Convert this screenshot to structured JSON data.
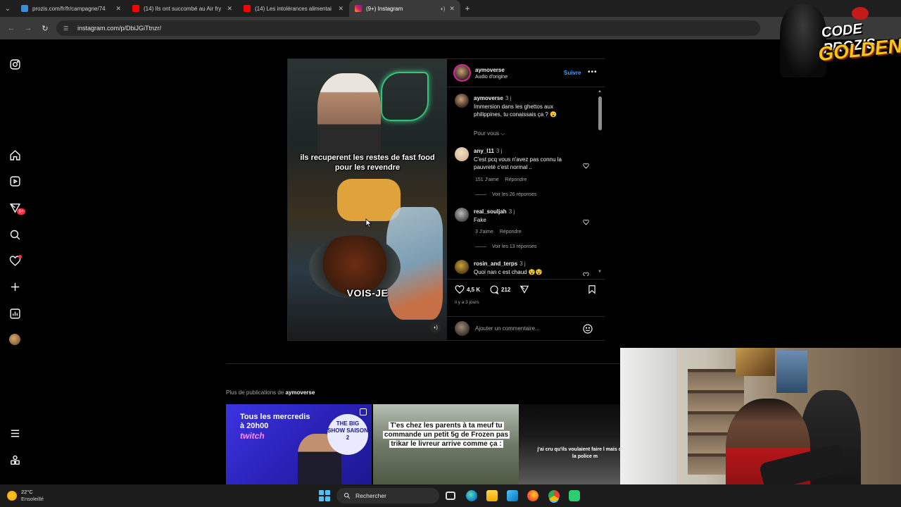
{
  "browser": {
    "tabs": [
      {
        "title": "prozis.com/fr/fr/campagne/74",
        "favicon": "prozis-favicon",
        "active": false
      },
      {
        "title": "(14) Ils ont succombé au Air fry",
        "favicon": "youtube-favicon",
        "active": false
      },
      {
        "title": "(14) Les intolérances alimentai",
        "favicon": "youtube-favicon",
        "active": false
      },
      {
        "title": "(9+) Instagram",
        "favicon": "instagram-favicon",
        "active": true
      }
    ],
    "url": "instagram.com/p/DbiJGiTtnzr/"
  },
  "rail": {
    "notifications_badge": "9+"
  },
  "post": {
    "video": {
      "caption_top": "ils recuperent les restes de fast food pour les revendre",
      "caption_bottom": "VOIS-JE"
    },
    "author": {
      "username": "aymoverse",
      "audio": "Audio d'origine",
      "follow_label": "Suivre"
    },
    "description": {
      "username": "aymoverse",
      "time": "3 j",
      "text": "Immersion dans les ghettos aux philippines, tu conaissais ça ? 😮"
    },
    "sort_label": "Pour vous ⌵",
    "comments": [
      {
        "username": "any_l11",
        "time": "3 j",
        "text": "C'est pcq vous n'avez pas connu la pauvreté c'est normal ..",
        "likes": "151 J'aime",
        "reply": "Répondre",
        "replies": "Voir les 26 réponses"
      },
      {
        "username": "real_souljah",
        "time": "3 j",
        "text": "Fake",
        "likes": "3 J'aime",
        "reply": "Répondre",
        "replies": "Voir les 13 réponses"
      },
      {
        "username": "rosin_and_terps",
        "time": "3 j",
        "text": "Quoi nan c est chaud 😵😵"
      }
    ],
    "likes_count": "4,5 K",
    "comments_count": "212",
    "posted": "il y a 3 jours",
    "add_comment_placeholder": "Ajouter un commentaire..."
  },
  "more_posts": {
    "prefix": "Plus de publications de ",
    "username": "aymoverse",
    "thumbs": [
      {
        "line1": "Tous les mercredis",
        "line2": "à 20h00",
        "platform": "twitch",
        "show": "THE BIG SHOW SAISON 2"
      },
      {
        "text": "T'es chez les parents à ta meuf tu commande un petit 5g de Frozen pas trikar le livreur arrive comme ça :"
      },
      {
        "text": "j'ai cru qu'ils voulaient faire l mais c'était la police m"
      }
    ]
  },
  "overlay": {
    "line1": "CODE PROZIS",
    "line2": "GOLDENG"
  },
  "taskbar": {
    "temperature": "22°C",
    "condition": "Ensoleillé",
    "search_label": "Rechercher"
  },
  "colors": {
    "accent": "#4a9eff",
    "notification": "#ff3040",
    "watermark_gold": "#f5c518"
  }
}
